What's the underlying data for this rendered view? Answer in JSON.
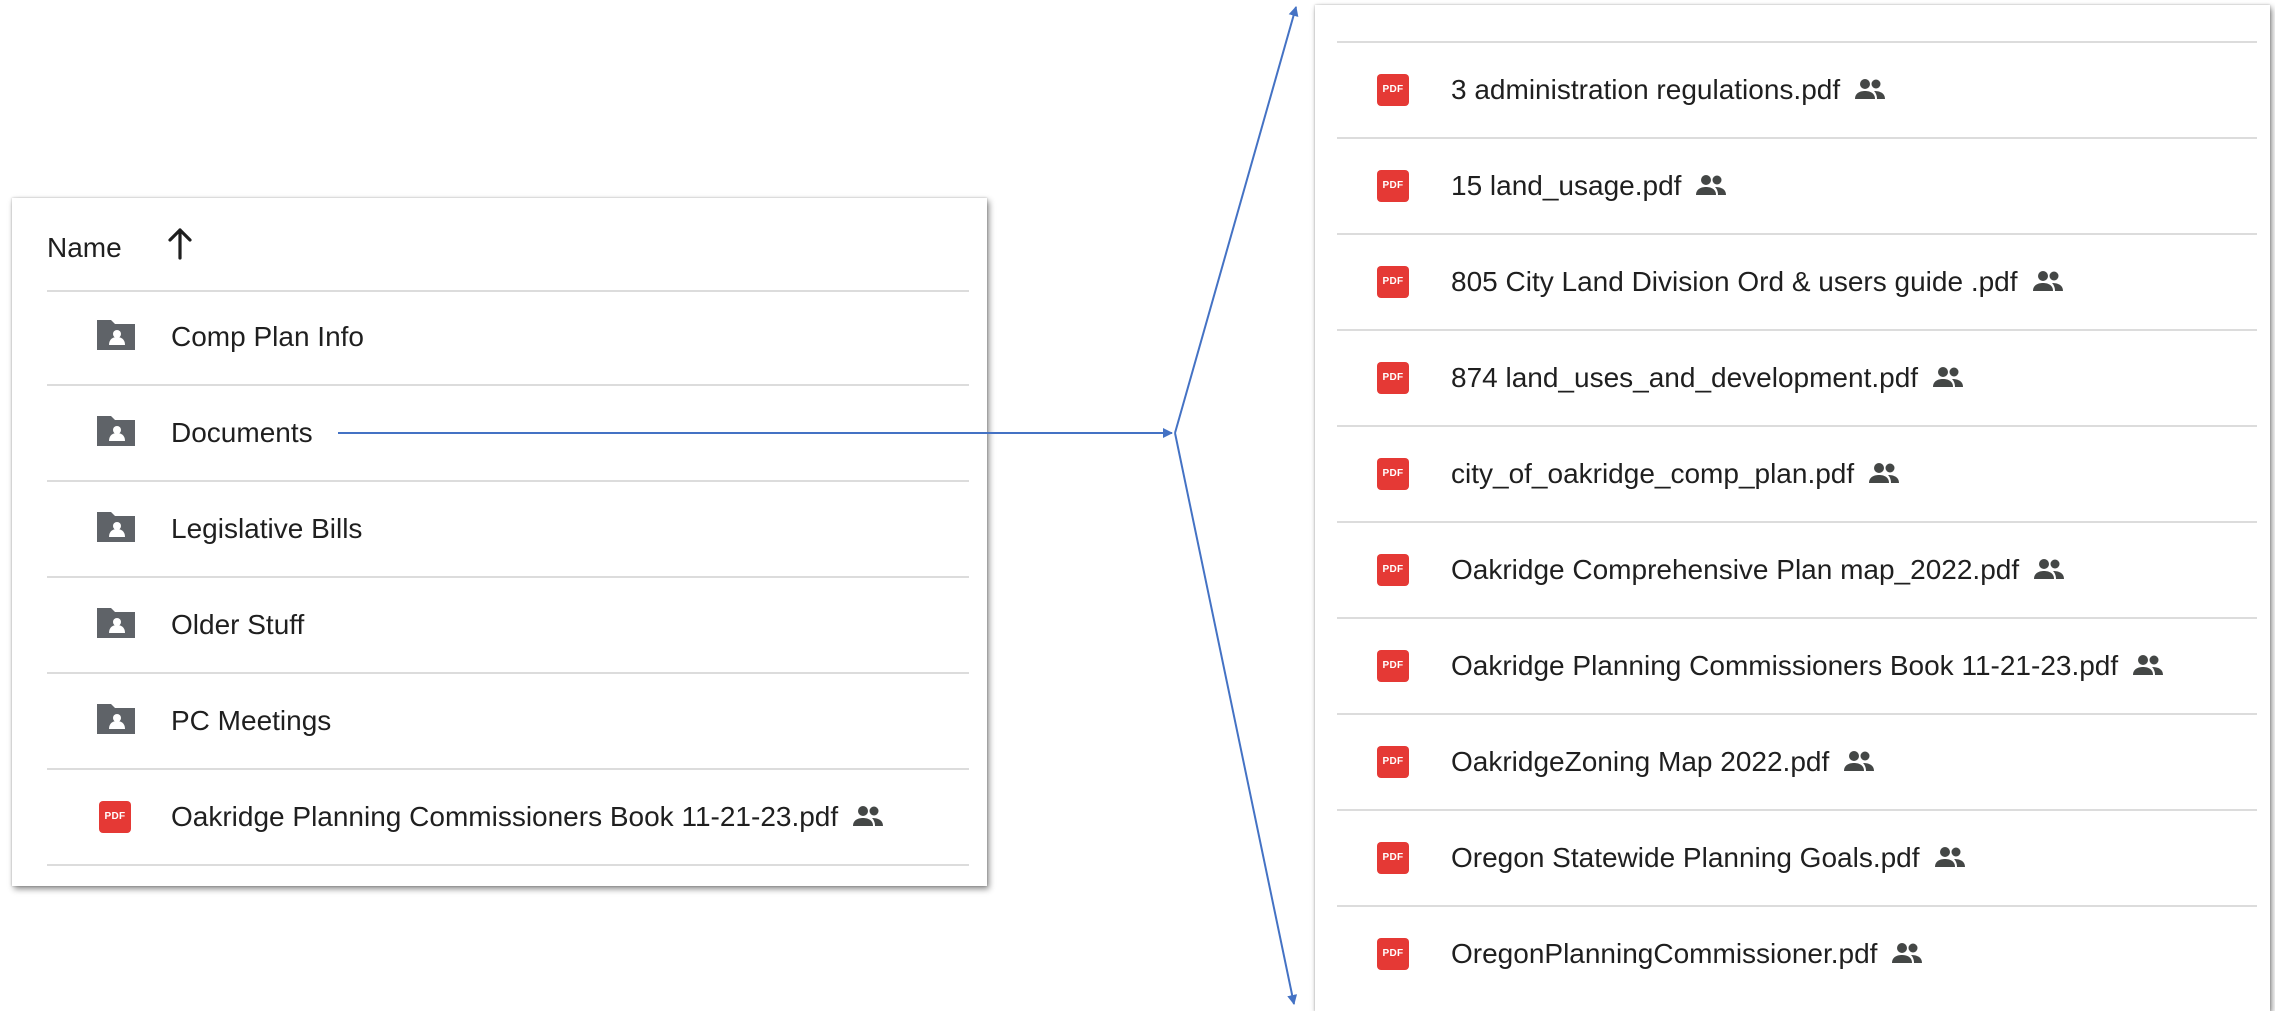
{
  "left_panel": {
    "header": {
      "name_label": "Name",
      "sort_icon": "arrow-up-icon"
    },
    "items": [
      {
        "label": "Comp Plan Info",
        "icon": "shared-folder-icon",
        "shared": false
      },
      {
        "label": "Documents",
        "icon": "shared-folder-icon",
        "shared": false
      },
      {
        "label": "Legislative Bills",
        "icon": "shared-folder-icon",
        "shared": false
      },
      {
        "label": "Older Stuff",
        "icon": "shared-folder-icon",
        "shared": false
      },
      {
        "label": "PC Meetings",
        "icon": "shared-folder-icon",
        "shared": false
      },
      {
        "label": "Oakridge Planning Commissioners Book 11-21-23.pdf",
        "icon": "pdf-icon",
        "shared": true
      }
    ]
  },
  "right_panel": {
    "items": [
      {
        "label": "3 administration regulations.pdf",
        "icon": "pdf-icon",
        "shared": true
      },
      {
        "label": "15 land_usage.pdf",
        "icon": "pdf-icon",
        "shared": true
      },
      {
        "label": "805 City Land Division Ord & users guide .pdf",
        "icon": "pdf-icon",
        "shared": true
      },
      {
        "label": "874 land_uses_and_development.pdf",
        "icon": "pdf-icon",
        "shared": true
      },
      {
        "label": "city_of_oakridge_comp_plan.pdf",
        "icon": "pdf-icon",
        "shared": true
      },
      {
        "label": "Oakridge Comprehensive Plan map_2022.pdf",
        "icon": "pdf-icon",
        "shared": true
      },
      {
        "label": "Oakridge Planning Commissioners Book 11-21-23.pdf",
        "icon": "pdf-icon",
        "shared": true
      },
      {
        "label": "OakridgeZoning Map 2022.pdf",
        "icon": "pdf-icon",
        "shared": true
      },
      {
        "label": "Oregon Statewide Planning Goals.pdf",
        "icon": "pdf-icon",
        "shared": true
      },
      {
        "label": "OregonPlanningCommissioner.pdf",
        "icon": "pdf-icon",
        "shared": true
      }
    ]
  },
  "pdf_badge_text": "PDF",
  "colors": {
    "pdf_red": "#e53935",
    "icon_gray": "#5f6368",
    "divider": "#dcdcdc",
    "connector_blue": "#4472c4"
  }
}
